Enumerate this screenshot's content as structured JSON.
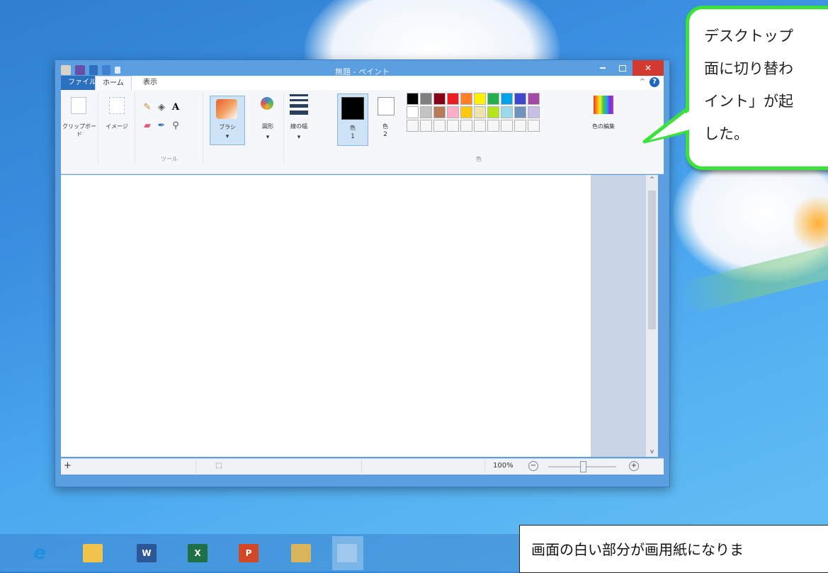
{
  "window": {
    "title": "無題 - ペイント",
    "minimize_glyph": "–",
    "maximize_glyph": "□",
    "close_glyph": "✕"
  },
  "ribbon_tabs": [
    {
      "label": "ファイル"
    },
    {
      "label": "ホーム"
    },
    {
      "label": "表示"
    }
  ],
  "ribbon": {
    "clipboard_label": "クリップボード",
    "image_label": "イメージ",
    "tools_group": "ツール",
    "brush_label": "ブラシ",
    "shapes_label": "図形",
    "line_width_label": "線の幅",
    "color1_label": "色",
    "color1_num": "1",
    "color2_label": "色",
    "color2_num": "2",
    "colors_group": "色",
    "edit_colors_label": "色の編集",
    "palette_row1": [
      "#000000",
      "#7f7f7f",
      "#880015",
      "#ed1c24",
      "#ff7f27",
      "#fff200",
      "#22b14c",
      "#00a2e8",
      "#3f48cc",
      "#a349a4"
    ],
    "palette_row2": [
      "#ffffff",
      "#c3c3c3",
      "#b97a57",
      "#ffaec9",
      "#ffc90e",
      "#efe4b0",
      "#b5e61d",
      "#99d9ea",
      "#7092be",
      "#c8bfe7"
    ],
    "palette_row3_count": 10
  },
  "statusbar": {
    "zoom": "100%",
    "zoom_fraction": 0.5
  },
  "callout": {
    "line1": "デスクトップ",
    "line2": "面に切り替わ",
    "line3": "イント」が起",
    "line4": "した。",
    "border_color": "#3ce23c"
  },
  "taskbar": {
    "apps": [
      {
        "name": "internet-explorer-icon",
        "glyph": "e",
        "color": "#1e8fe0"
      },
      {
        "name": "file-explorer-icon",
        "glyph": "",
        "color": "#f1c34a"
      },
      {
        "name": "word-icon",
        "glyph": "W",
        "color": "#2b5797"
      },
      {
        "name": "excel-icon",
        "glyph": "X",
        "color": "#1e7145"
      },
      {
        "name": "powerpoint-icon",
        "glyph": "P",
        "color": "#d24726"
      },
      {
        "name": "library-icon",
        "glyph": "",
        "color": "#d9b45a"
      },
      {
        "name": "paint-icon",
        "glyph": "",
        "color": "#9fc8ef"
      }
    ]
  },
  "note": {
    "text": "画面の白い部分が画用紙になりま"
  }
}
